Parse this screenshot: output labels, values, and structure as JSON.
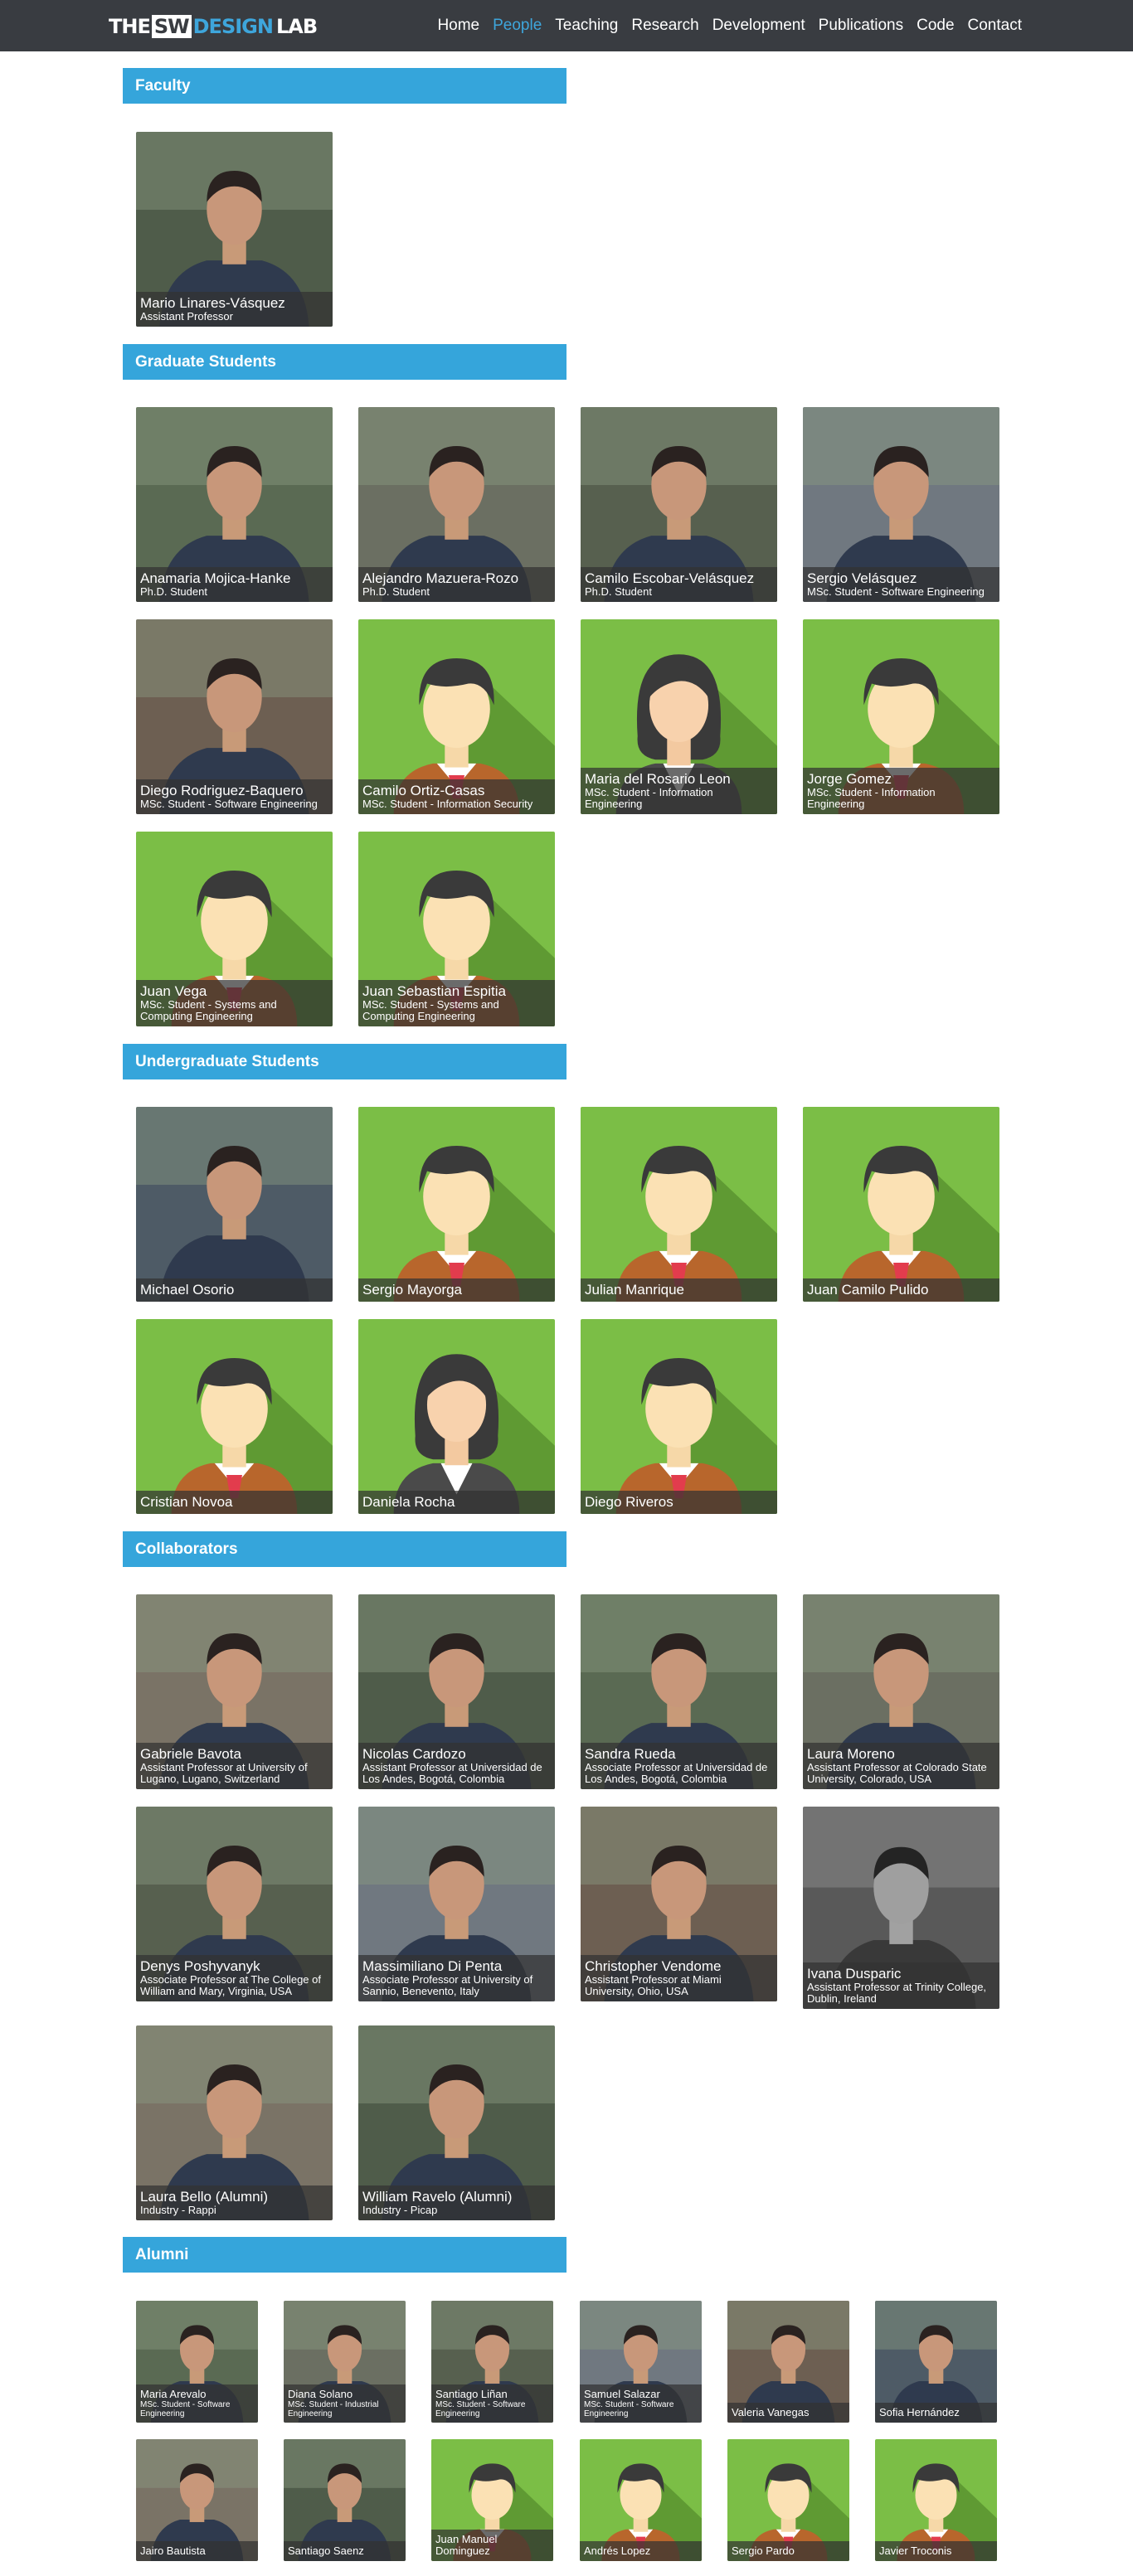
{
  "nav": {
    "logo": {
      "the": "THE",
      "sw": "SW",
      "design": "DESIGN",
      "lab": "LAB"
    },
    "items": [
      "Home",
      "People",
      "Teaching",
      "Research",
      "Development",
      "Publications",
      "Code",
      "Contact"
    ],
    "active": "People"
  },
  "colors": {
    "nav_bg": "#393c41",
    "accent": "#35a5db",
    "avatar_green": "#7bbe46"
  },
  "sections": {
    "faculty": "Faculty",
    "graduate": "Graduate Students",
    "undergrad": "Undergraduate Students",
    "collaborators": "Collaborators",
    "alumni": "Alumni"
  },
  "faculty": [
    {
      "name": "Mario Linares-Vásquez",
      "role": "Assistant Professor",
      "avatar": "photo"
    }
  ],
  "graduate": [
    {
      "name": "Anamaria Mojica-Hanke",
      "role": "Ph.D. Student",
      "avatar": "photo"
    },
    {
      "name": "Alejandro Mazuera-Rozo",
      "role": "Ph.D. Student",
      "avatar": "photo"
    },
    {
      "name": "Camilo Escobar-Velásquez",
      "role": "Ph.D. Student",
      "avatar": "photo"
    },
    {
      "name": "Sergio Velásquez",
      "role": "MSc. Student - Software Engineering",
      "avatar": "photo"
    },
    {
      "name": "Diego Rodriguez-Baquero",
      "role": "MSc. Student - Software Engineering",
      "avatar": "photo"
    },
    {
      "name": "Camilo Ortiz-Casas",
      "role": "MSc. Student - Information Security",
      "avatar": "male"
    },
    {
      "name": "Maria del Rosario Leon",
      "role": "MSc. Student - Information Engineering",
      "avatar": "female"
    },
    {
      "name": "Jorge Gomez",
      "role": "MSc. Student - Information Engineering",
      "avatar": "male"
    },
    {
      "name": "Juan Vega",
      "role": "MSc. Student - Systems and Computing Engineering",
      "avatar": "male"
    },
    {
      "name": "Juan Sebastian Espitia",
      "role": "MSc. Student - Systems and Computing Engineering",
      "avatar": "male"
    }
  ],
  "undergrad": [
    {
      "name": "Michael Osorio",
      "role": "",
      "avatar": "photo"
    },
    {
      "name": "Sergio Mayorga",
      "role": "",
      "avatar": "male"
    },
    {
      "name": "Julian Manrique",
      "role": "",
      "avatar": "male"
    },
    {
      "name": "Juan Camilo Pulido",
      "role": "",
      "avatar": "male"
    },
    {
      "name": "Cristian Novoa",
      "role": "",
      "avatar": "male"
    },
    {
      "name": "Daniela Rocha",
      "role": "",
      "avatar": "female"
    },
    {
      "name": "Diego Riveros",
      "role": "",
      "avatar": "male"
    }
  ],
  "collaborators": [
    {
      "name": "Gabriele Bavota",
      "role": "Assistant Professor at University of Lugano, Lugano, Switzerland",
      "avatar": "photo"
    },
    {
      "name": "Nicolas Cardozo",
      "role": "Assistant Professor at Universidad de Los Andes, Bogotá, Colombia",
      "avatar": "photo"
    },
    {
      "name": "Sandra Rueda",
      "role": "Associate Professor at Universidad de Los Andes, Bogotá, Colombia",
      "avatar": "photo"
    },
    {
      "name": "Laura Moreno",
      "role": "Assistant Professor at Colorado State University, Colorado, USA",
      "avatar": "photo"
    },
    {
      "name": "Denys Poshyvanyk",
      "role": "Associate Professor at The College of William and Mary, Virginia, USA",
      "avatar": "photo"
    },
    {
      "name": "Massimiliano Di Penta",
      "role": "Associate Professor at University of Sannio, Benevento, Italy",
      "avatar": "photo"
    },
    {
      "name": "Christopher Vendome",
      "role": "Assistant Professor at Miami University, Ohio, USA",
      "avatar": "photo"
    },
    {
      "name": "Ivana Dusparic",
      "role": "Assistant Professor at Trinity College, Dublin, Ireland",
      "avatar": "photo"
    },
    {
      "name": "Laura Bello (Alumni)",
      "role": "Industry - Rappi",
      "avatar": "photo"
    },
    {
      "name": "William Ravelo (Alumni)",
      "role": "Industry - Picap",
      "avatar": "photo"
    }
  ],
  "alumni": [
    {
      "name": "Maria Arevalo",
      "role": "MSc. Student - Software Engineering",
      "avatar": "photo"
    },
    {
      "name": "Diana Solano",
      "role": "MSc. Student - Industrial Engineering",
      "avatar": "photo"
    },
    {
      "name": "Santiago Liñan",
      "role": "MSc. Student - Software Engineering",
      "avatar": "photo"
    },
    {
      "name": "Samuel Salazar",
      "role": "MSc. Student - Software Engineering",
      "avatar": "photo"
    },
    {
      "name": "Valeria Vanegas",
      "role": "",
      "avatar": "photo"
    },
    {
      "name": "Sofia Hernández",
      "role": "",
      "avatar": "photo"
    },
    {
      "name": "Jairo Bautista",
      "role": "",
      "avatar": "photo"
    },
    {
      "name": "Santiago Saenz",
      "role": "",
      "avatar": "photo"
    },
    {
      "name": "Juan Manuel Dominguez",
      "role": "",
      "avatar": "male"
    },
    {
      "name": "Andrés Lopez",
      "role": "",
      "avatar": "male"
    },
    {
      "name": "Sergio Pardo",
      "role": "",
      "avatar": "male"
    },
    {
      "name": "Javier Troconis",
      "role": "",
      "avatar": "male"
    }
  ]
}
